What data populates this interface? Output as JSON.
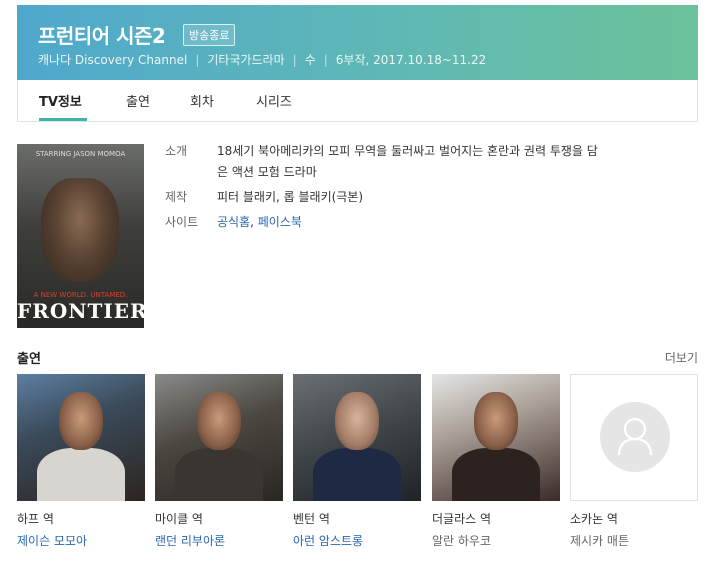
{
  "header": {
    "title": "프런티어 시즌2",
    "badge": "방송종료",
    "meta": [
      "캐나다 Discovery Channel",
      "기타국가드라마",
      "수",
      "6부작, 2017.10.18~11.22"
    ]
  },
  "tabs": [
    {
      "label": "TV정보",
      "active": true
    },
    {
      "label": "출연",
      "active": false
    },
    {
      "label": "회차",
      "active": false
    },
    {
      "label": "시리즈",
      "active": false
    }
  ],
  "poster": {
    "top_text": "STARRING JASON MOMOA",
    "tagline": "A NEW WORLD. UNTAMED.",
    "name": "FRONTIER"
  },
  "info": {
    "intro_label": "소개",
    "intro_line1": "18세기 북아메리카의 모피 무역을 둘러싸고 벌어지는 혼란과 권력 투쟁을 담",
    "intro_line2": "은 액션 모험 드라마",
    "producer_label": "제작",
    "producer_value": "피터 블래키, 롭 블래키(극본)",
    "site_label": "사이트",
    "site_link1": "공식홈",
    "site_sep": ", ",
    "site_link2": "페이스북"
  },
  "cast": {
    "heading": "출연",
    "more": "더보기",
    "items": [
      {
        "role": "하프 역",
        "name": "제이슨 모모아"
      },
      {
        "role": "마이클 역",
        "name": "랜던 리부아론"
      },
      {
        "role": "벤턴 역",
        "name": "아런 암스트롱"
      },
      {
        "role": "더글라스 역",
        "name": "알란 하우코"
      },
      {
        "role": "소카논 역",
        "name": "제시카 매튼"
      }
    ]
  },
  "colors": {
    "accent": "#3fb4a6",
    "link": "#2866b2",
    "header_left": "#4fa8cc",
    "header_right": "#6cc29a"
  }
}
